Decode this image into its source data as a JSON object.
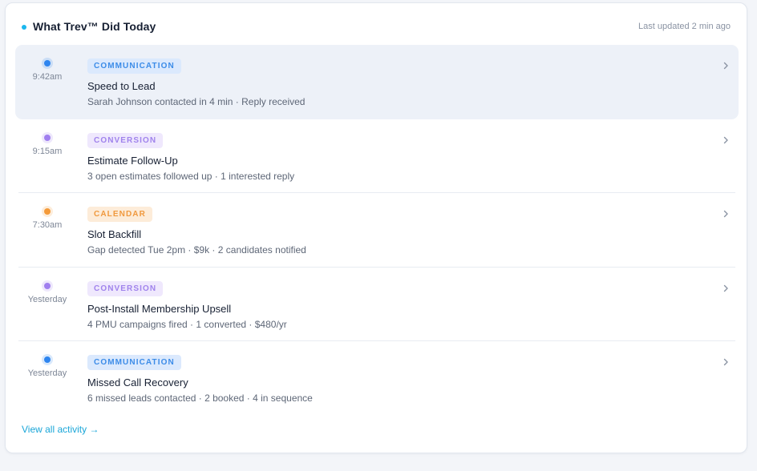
{
  "header": {
    "title": "What Trev™ Did Today",
    "updated": "Last updated 2 min ago",
    "dot_color": "#1bb7ee"
  },
  "colors": {
    "communication": "#2f86f0",
    "conversion": "#a07ff0",
    "calendar": "#f59a3a"
  },
  "activities": [
    {
      "time": "9:42am",
      "category": "COMMUNICATION",
      "category_key": "communication",
      "title": "Speed to Lead",
      "description": "Sarah Johnson contacted in 4 min · Reply received",
      "dot_color": "#2f86f0",
      "active": true,
      "chevron_icon": "chevron-right-icon"
    },
    {
      "time": "9:15am",
      "category": "CONVERSION",
      "category_key": "conversion",
      "title": "Estimate Follow-Up",
      "description": "3 open estimates followed up · 1 interested reply",
      "dot_color": "#a07ff0",
      "active": false,
      "chevron_icon": "chevron-right-icon"
    },
    {
      "time": "7:30am",
      "category": "CALENDAR",
      "category_key": "calendar",
      "title": "Slot Backfill",
      "description": "Gap detected Tue 2pm · $9k · 2 candidates notified",
      "dot_color": "#f59a3a",
      "active": false,
      "chevron_icon": "chevron-right-icon"
    },
    {
      "time": "Yesterday",
      "category": "CONVERSION",
      "category_key": "conversion",
      "title": "Post-Install Membership Upsell",
      "description": "4 PMU campaigns fired · 1 converted · $480/yr",
      "dot_color": "#a07ff0",
      "active": false,
      "chevron_icon": "chevron-right-icon"
    },
    {
      "time": "Yesterday",
      "category": "COMMUNICATION",
      "category_key": "communication",
      "title": "Missed Call Recovery",
      "description": "6 missed leads contacted · 2 booked · 4 in sequence",
      "dot_color": "#2f86f0",
      "active": false,
      "chevron_icon": "chevron-right-icon"
    }
  ],
  "footer": {
    "view_all": "View all activity →"
  }
}
